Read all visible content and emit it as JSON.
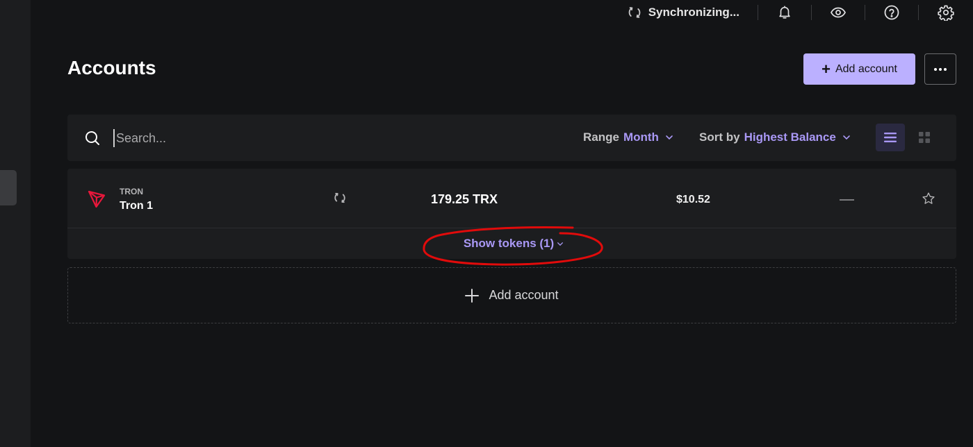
{
  "topbar": {
    "sync_status": "Synchronizing...",
    "icons": [
      "bell-icon",
      "eye-icon",
      "help-icon",
      "settings-icon"
    ]
  },
  "header": {
    "title": "Accounts",
    "add_account_label": "Add account",
    "more_icon": "more-horizontal-icon"
  },
  "toolbar": {
    "search_placeholder": "Search...",
    "range_label": "Range",
    "range_value": "Month",
    "sort_label": "Sort by",
    "sort_value": "Highest Balance",
    "view_modes": [
      "list",
      "grid"
    ],
    "active_view": "list"
  },
  "accounts": [
    {
      "currency": "TRON",
      "name": "Tron 1",
      "balance": "179.25 TRX",
      "fiat_value": "$10.52",
      "change": "—",
      "show_tokens_label": "Show tokens (1)"
    }
  ],
  "add_account_row": {
    "label": "Add account"
  },
  "colors": {
    "background": "#131416",
    "surface": "#1c1d1f",
    "accent": "#a998f5",
    "primary_button": "#bbb0ff",
    "tron_red": "#e8173b",
    "annotation_red": "#e10b0b"
  }
}
